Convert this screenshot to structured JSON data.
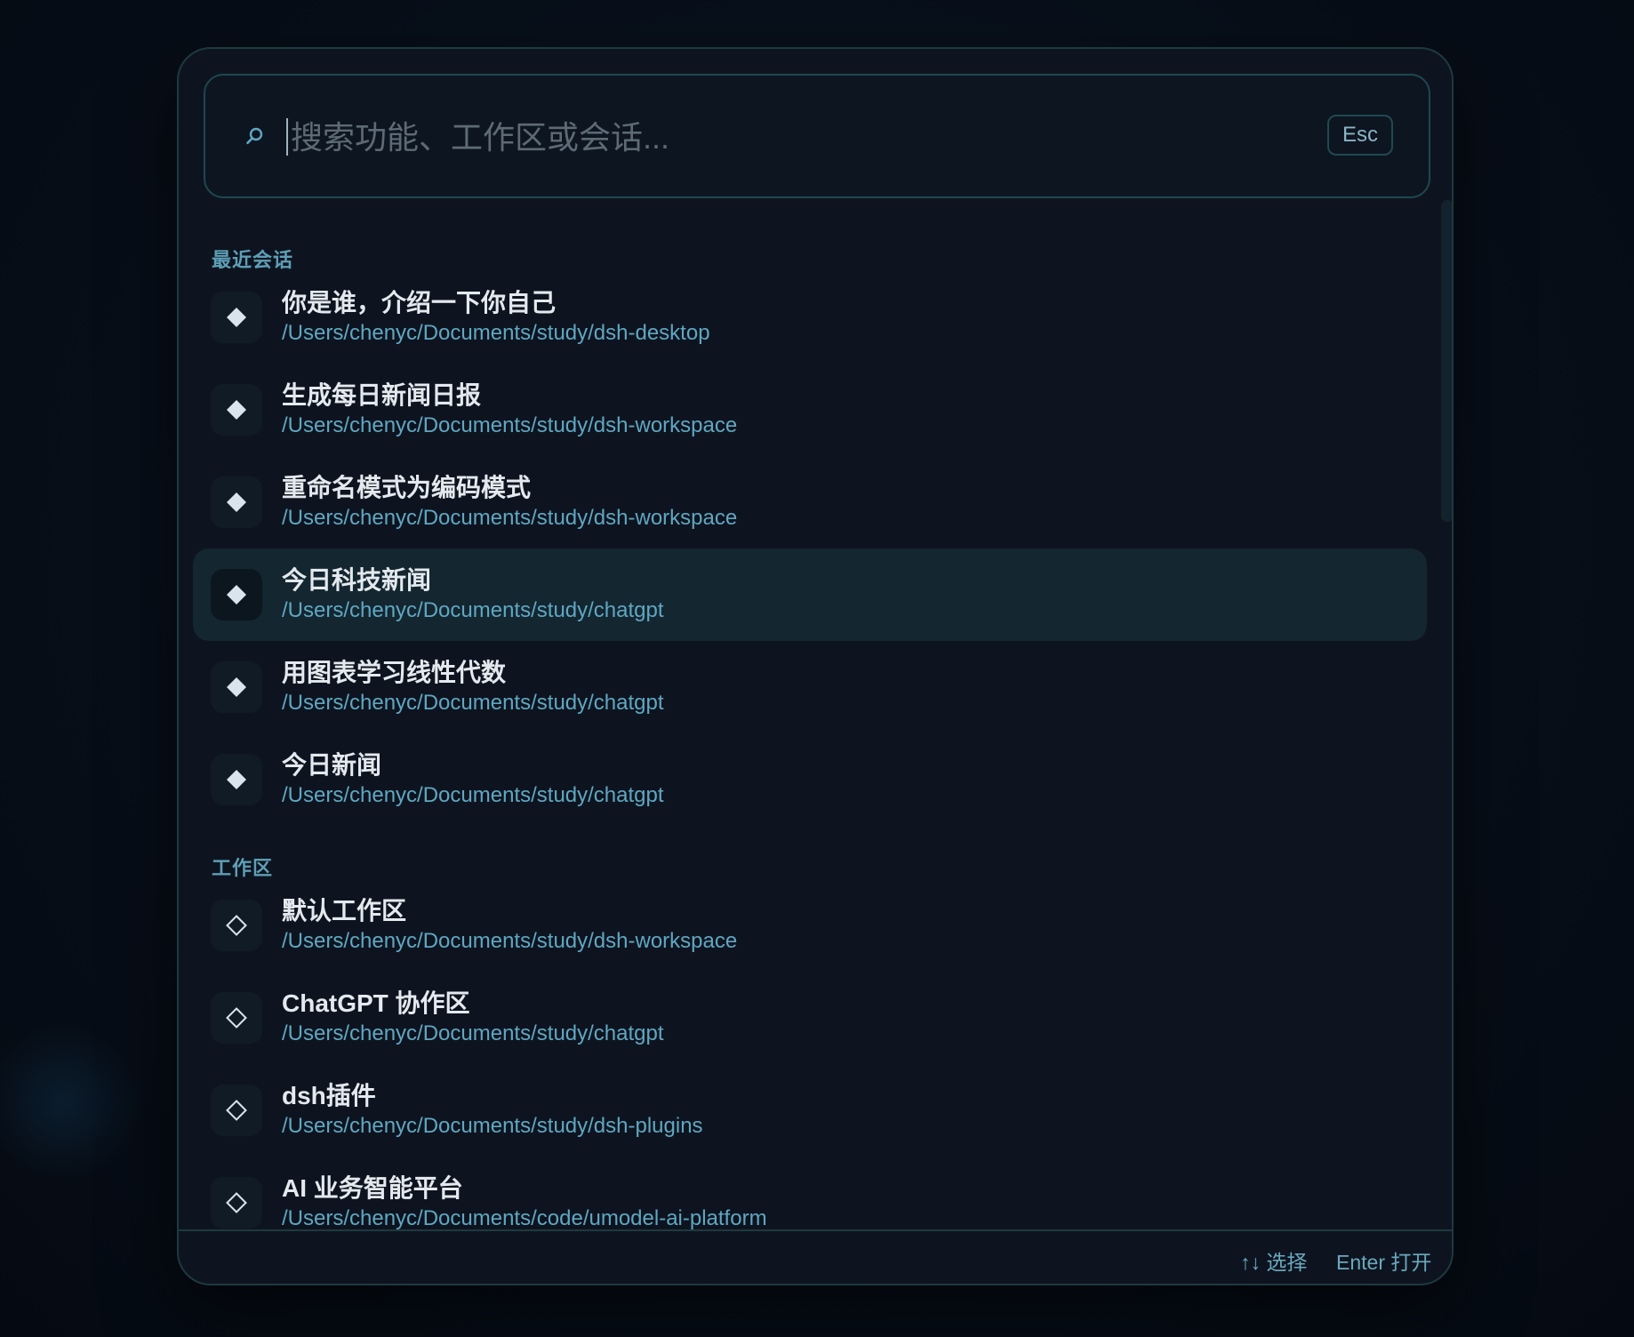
{
  "search": {
    "placeholder": "搜索功能、工作区或会话...",
    "value": "",
    "esc_label": "Esc"
  },
  "sections": [
    {
      "title": "最近会话",
      "icon": "filled-diamond-icon",
      "items": [
        {
          "title": "你是谁，介绍一下你自己",
          "path": "/Users/chenyc/Documents/study/dsh-desktop"
        },
        {
          "title": "生成每日新闻日报",
          "path": "/Users/chenyc/Documents/study/dsh-workspace"
        },
        {
          "title": "重命名模式为编码模式",
          "path": "/Users/chenyc/Documents/study/dsh-workspace"
        },
        {
          "title": "今日科技新闻",
          "path": "/Users/chenyc/Documents/study/chatgpt",
          "selected": true
        },
        {
          "title": "用图表学习线性代数",
          "path": "/Users/chenyc/Documents/study/chatgpt"
        },
        {
          "title": "今日新闻",
          "path": "/Users/chenyc/Documents/study/chatgpt"
        }
      ]
    },
    {
      "title": "工作区",
      "icon": "outline-diamond-icon",
      "items": [
        {
          "title": "默认工作区",
          "path": "/Users/chenyc/Documents/study/dsh-workspace"
        },
        {
          "title": "ChatGPT 协作区",
          "path": "/Users/chenyc/Documents/study/chatgpt"
        },
        {
          "title": "dsh插件",
          "path": "/Users/chenyc/Documents/study/dsh-plugins"
        },
        {
          "title": "AI 业务智能平台",
          "path": "/Users/chenyc/Documents/code/umodel-ai-platform"
        }
      ]
    }
  ],
  "footer": {
    "navigate_hint": "↑↓ 选择",
    "open_hint": "Enter 打开"
  },
  "colors": {
    "accent": "#5fa7c2",
    "selected_background": "#142630",
    "panel_background": "#0e141f"
  }
}
